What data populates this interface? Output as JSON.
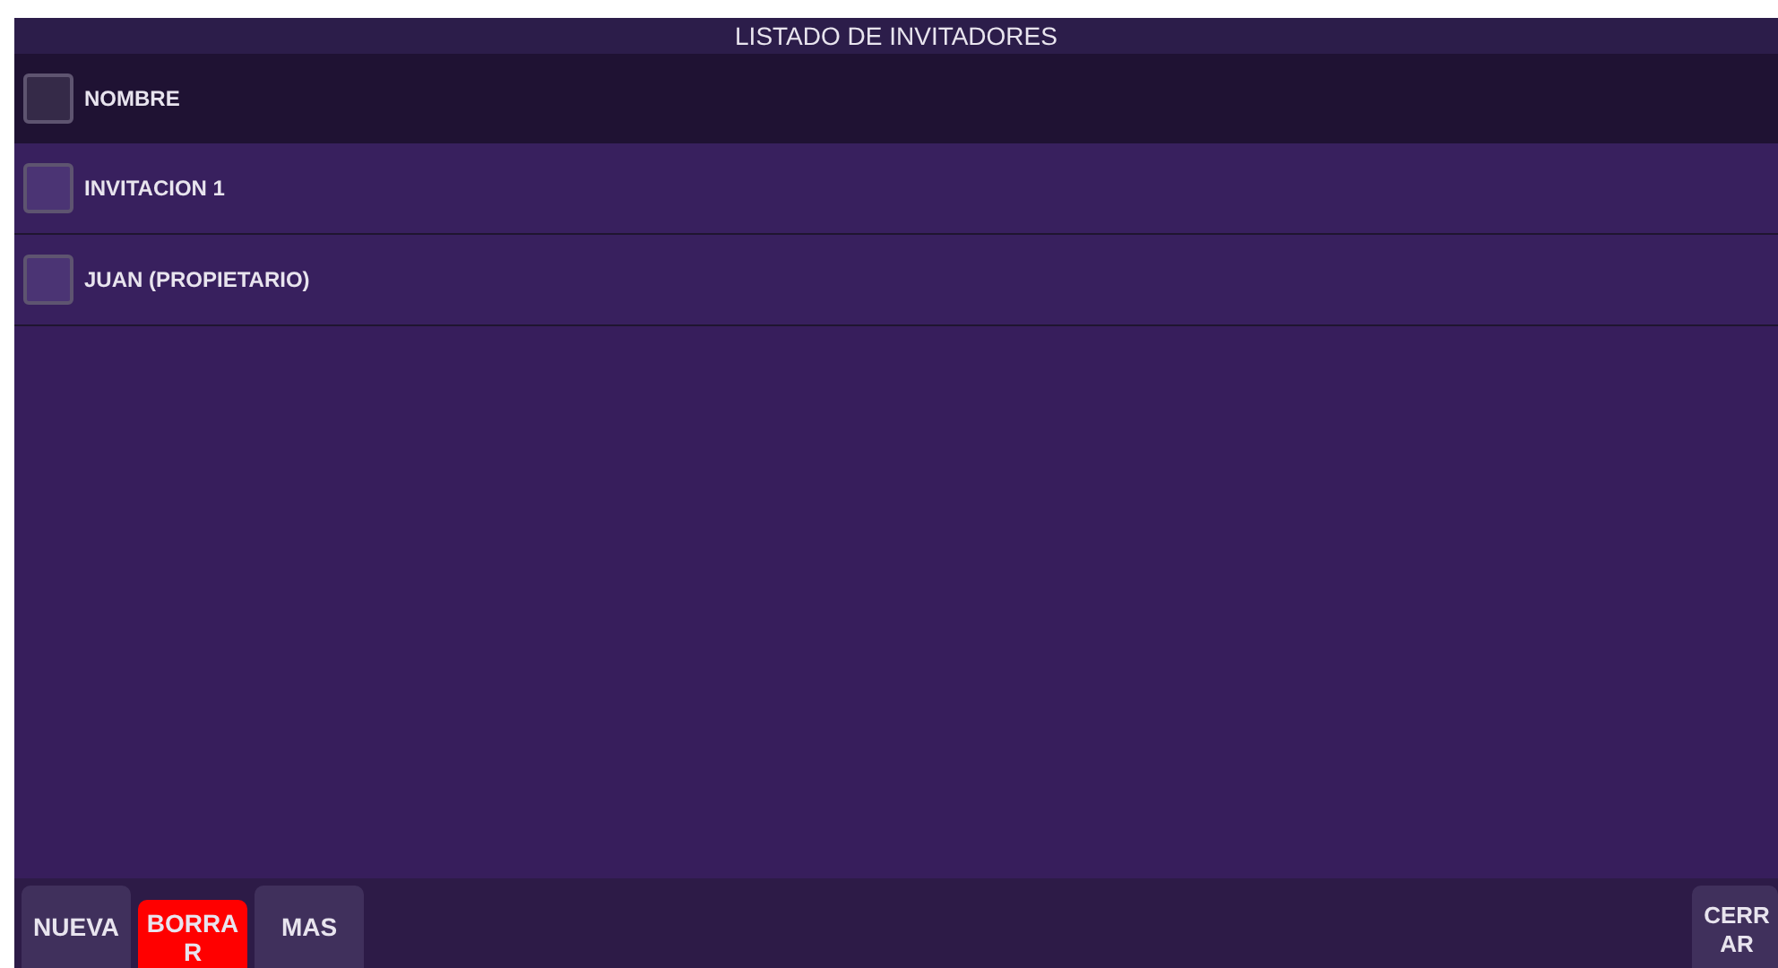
{
  "title": "LISTADO DE INVITADORES",
  "header": {
    "label": "NOMBRE",
    "checked": false
  },
  "rows": [
    {
      "label": "INVITACION 1",
      "checked": false
    },
    {
      "label": "JUAN (PROPIETARIO)",
      "checked": false
    }
  ],
  "buttons": [
    {
      "label": "NUEVA",
      "kind": "normal"
    },
    {
      "label": "BORRAR",
      "kind": "danger"
    },
    {
      "label": "MAS",
      "kind": "normal"
    }
  ],
  "close_button": {
    "label": "CERRAR"
  }
}
